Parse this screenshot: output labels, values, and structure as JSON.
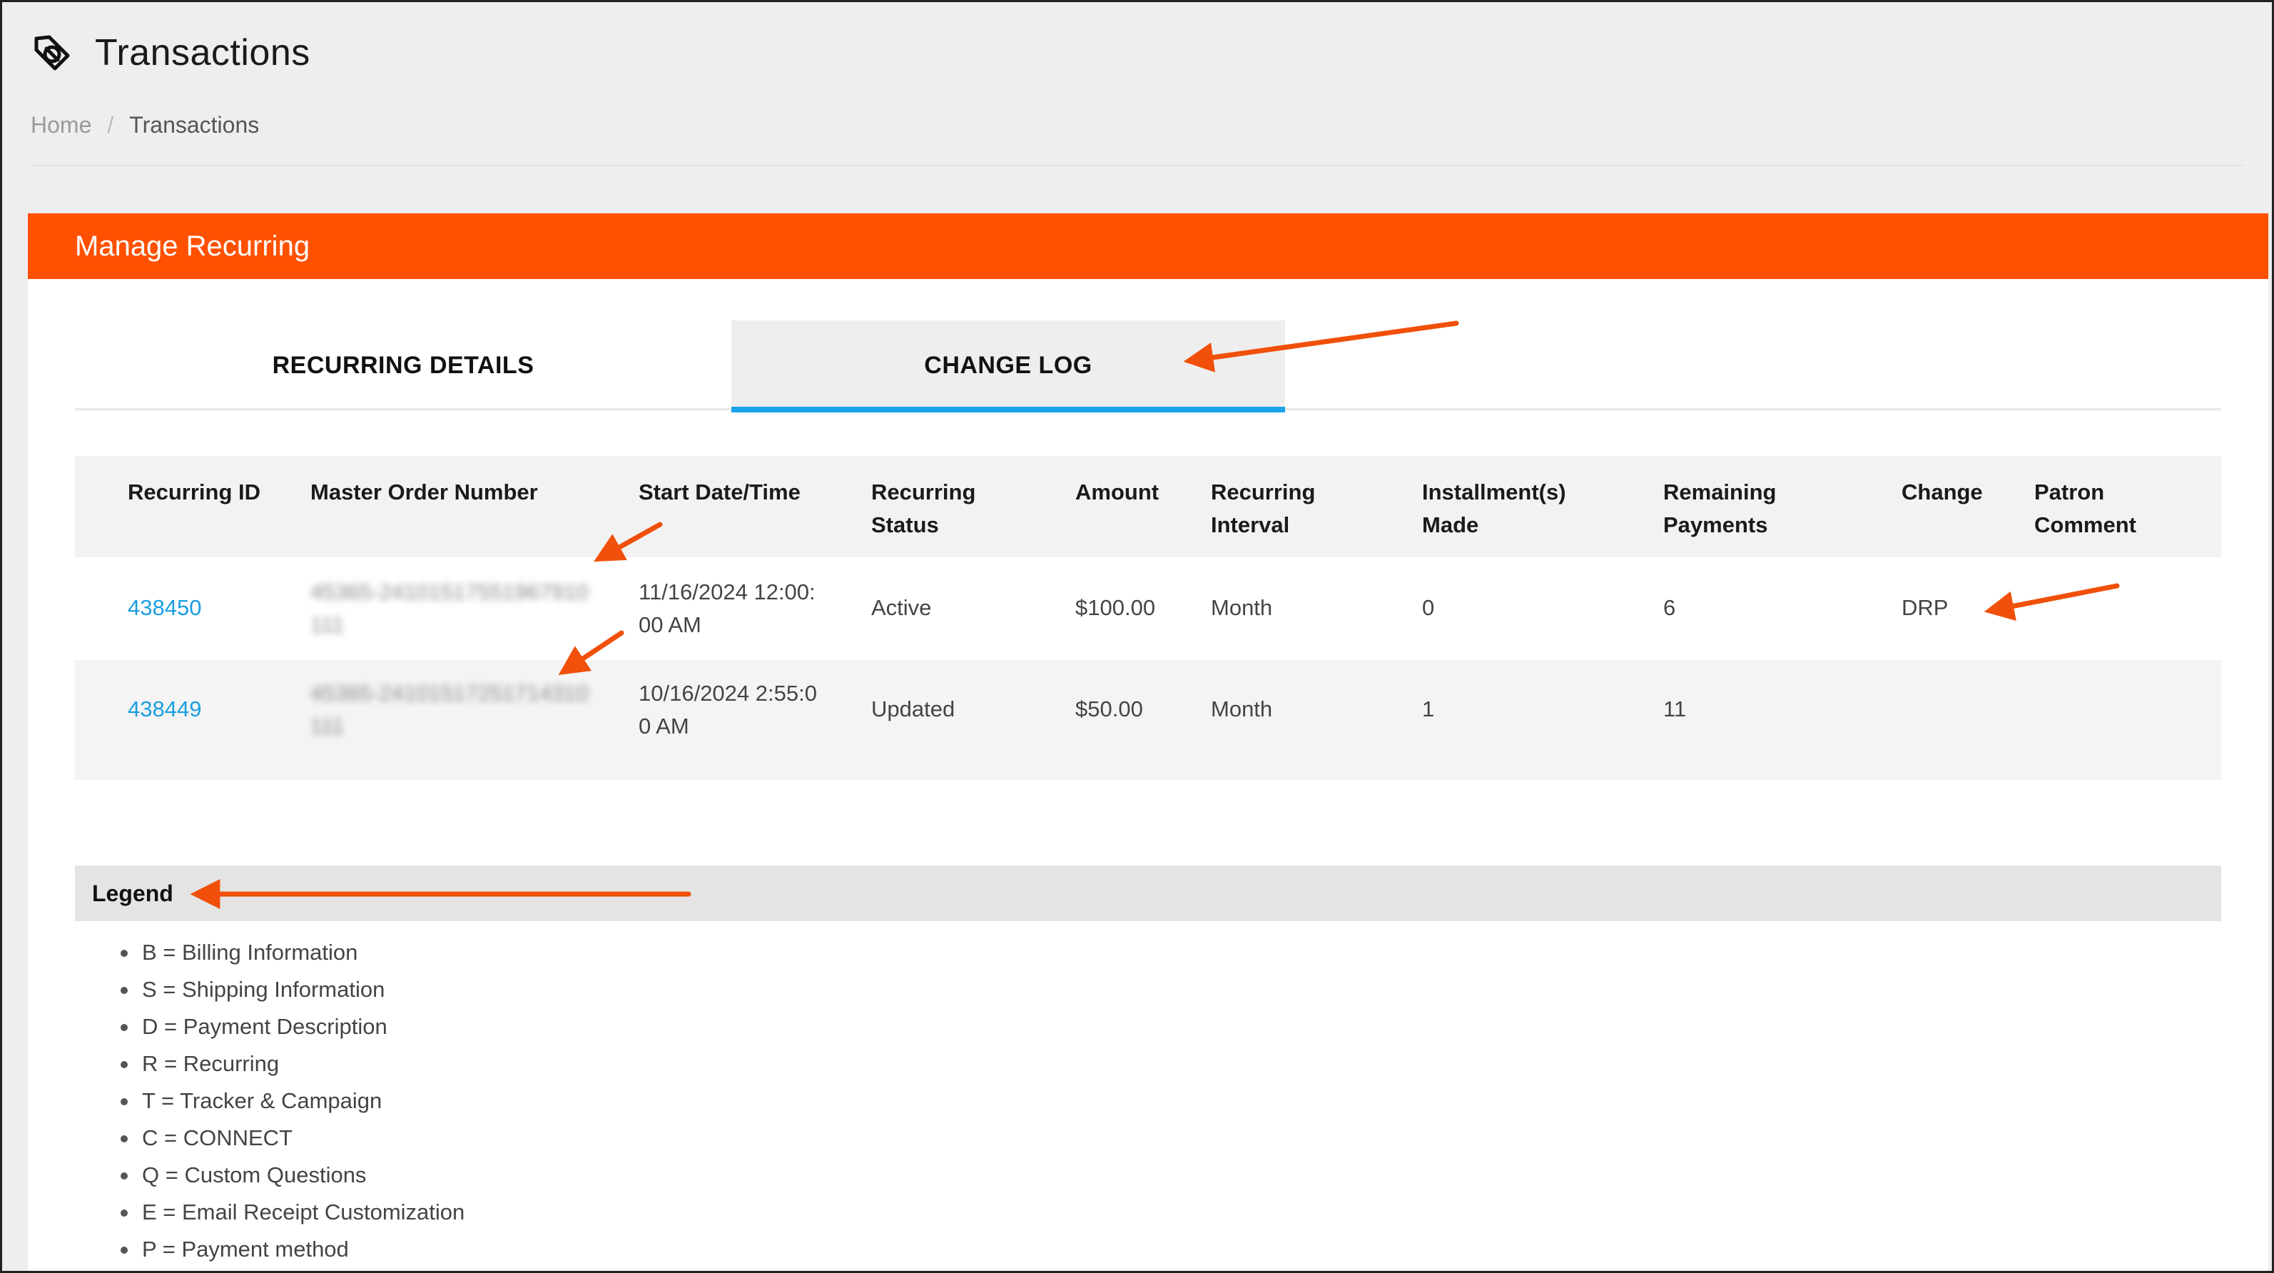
{
  "header": {
    "title": "Transactions",
    "logo_icon": "tag-logo-icon"
  },
  "breadcrumb": {
    "home": "Home",
    "separator": "/",
    "current": "Transactions"
  },
  "panel": {
    "title": "Manage Recurring",
    "accent_color": "#ff5100"
  },
  "tabs": [
    {
      "label": "RECURRING DETAILS",
      "active": false
    },
    {
      "label": "CHANGE LOG",
      "active": true
    }
  ],
  "table": {
    "columns": {
      "recurring_id": "Recurring ID",
      "master_order": "Master Order Number",
      "start_date_1": "Start Date/Time",
      "status_1": "Recurring",
      "status_2": "Status",
      "amount": "Amount",
      "interval_1": "Recurring",
      "interval_2": "Interval",
      "installments_1": "Installment(s)",
      "installments_2": "Made",
      "remaining_1": "Remaining",
      "remaining_2": "Payments",
      "change": "Change",
      "comment_1": "Patron",
      "comment_2": "Comment"
    },
    "rows": [
      {
        "id": "438450",
        "order_1": "45365-24101517551967910",
        "order_2": "111",
        "start_1": "11/16/2024 12:00:",
        "start_2": "00 AM",
        "status": "Active",
        "amount": "$100.00",
        "interval": "Month",
        "installments": "0",
        "remaining": "6",
        "change": "DRP",
        "comment": ""
      },
      {
        "id": "438449",
        "order_1": "45365-24101517251714310",
        "order_2": "111",
        "start_1": "10/16/2024 2:55:0",
        "start_2": "0 AM",
        "status": "Updated",
        "amount": "$50.00",
        "interval": "Month",
        "installments": "1",
        "remaining": "11",
        "change": "",
        "comment": ""
      }
    ]
  },
  "legend": {
    "title": "Legend",
    "items": [
      "B = Billing Information",
      "S = Shipping Information",
      "D = Payment Description",
      "R = Recurring",
      "T = Tracker & Campaign",
      "C = CONNECT",
      "Q = Custom Questions",
      "E = Email Receipt Customization",
      "P = Payment method"
    ]
  },
  "colors": {
    "tab_underline": "#1aa3e8",
    "link": "#1a9ee0",
    "annotation_arrow": "#f0500a"
  }
}
